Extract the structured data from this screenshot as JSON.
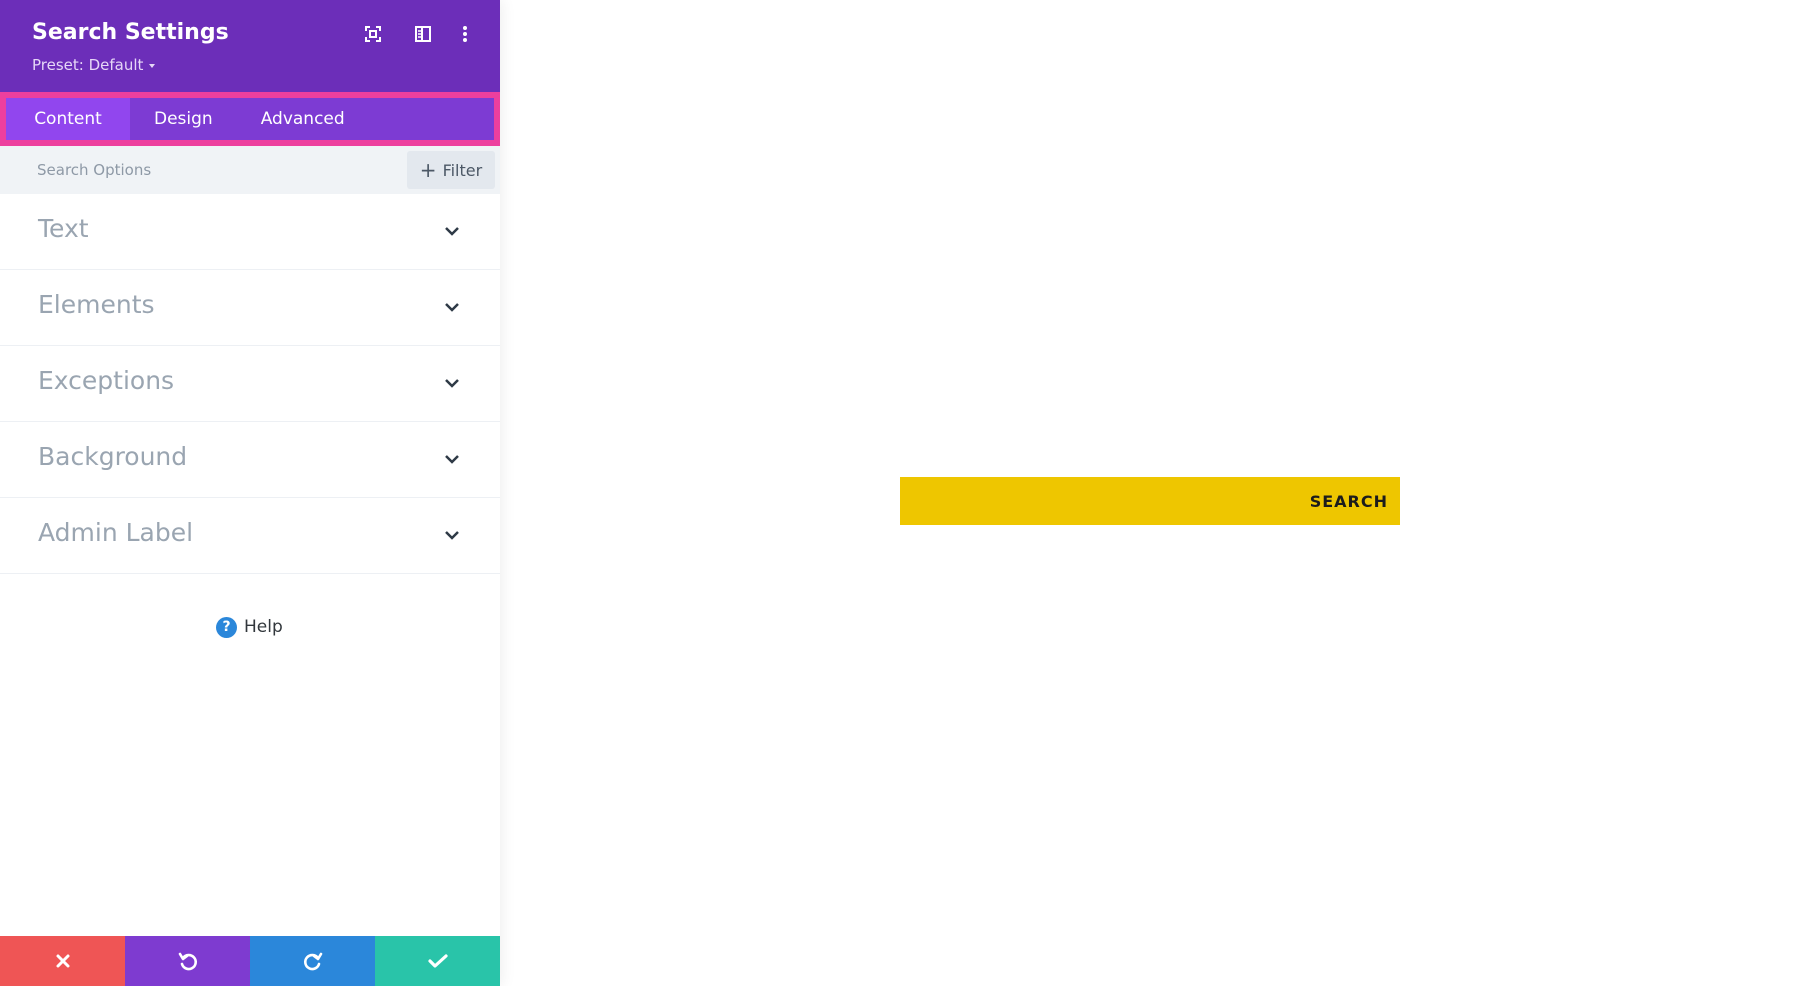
{
  "panel": {
    "title": "Search Settings",
    "preset_label": "Preset: Default",
    "header_icons": [
      "fullscreen-icon",
      "split-view-icon",
      "more-options-icon"
    ]
  },
  "tabs": [
    {
      "label": "Content",
      "active": true
    },
    {
      "label": "Design",
      "active": false
    },
    {
      "label": "Advanced",
      "active": false
    }
  ],
  "search": {
    "placeholder": "Search Options",
    "value": "",
    "filter_label": "Filter"
  },
  "sections": [
    {
      "label": "Text"
    },
    {
      "label": "Elements"
    },
    {
      "label": "Exceptions"
    },
    {
      "label": "Background"
    },
    {
      "label": "Admin Label"
    }
  ],
  "help": {
    "label": "Help"
  },
  "footer": {
    "buttons": [
      {
        "icon": "close-icon",
        "color": "#ef5555"
      },
      {
        "icon": "undo-icon",
        "color": "#7e3bd0"
      },
      {
        "icon": "redo-icon",
        "color": "#2b87da"
      },
      {
        "icon": "checkmark-icon",
        "color": "#29c4a9"
      }
    ]
  },
  "preview": {
    "search_value": "",
    "button_label": "SEARCH",
    "bar_color": "#eec600"
  },
  "colors": {
    "header_bg": "#6c2eb9",
    "tab_bar_highlight": "#ed3f9e",
    "tab_bg": "#7d3bd3",
    "tab_active_bg": "#9146ee"
  }
}
